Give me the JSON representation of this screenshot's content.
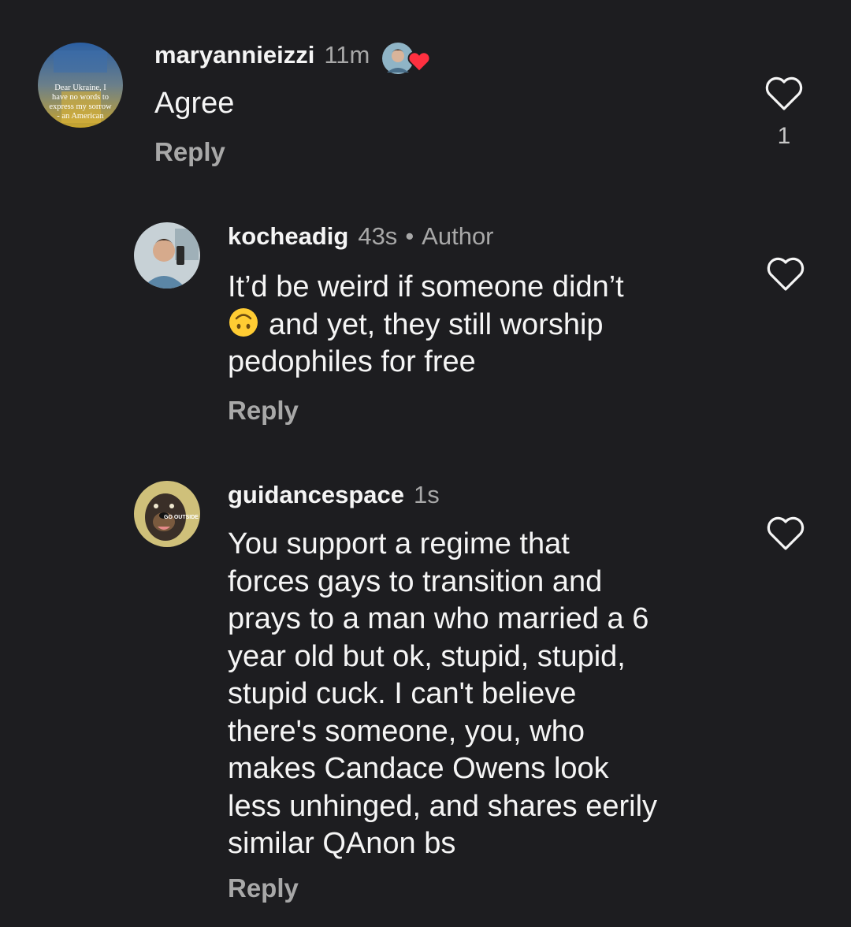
{
  "comments": [
    {
      "username": "maryannieizzi",
      "time": "11m",
      "text": "Agree",
      "reply_label": "Reply",
      "like_count": "1",
      "avatar_caption_lines": [
        "Dear Ukraine, I",
        "have no words to",
        "express my sorrow",
        "- an American"
      ],
      "has_author_reaction": true
    },
    {
      "username": "kocheadig",
      "time": "43s",
      "separator": "•",
      "author_badge": "Author",
      "text_lines": [
        "It’d be weird if someone didn’t",
        "and yet, they still worship",
        "pedophiles for free"
      ],
      "emoji": "upside-down-face",
      "reply_label": "Reply"
    },
    {
      "username": "guidancespace",
      "time": "1s",
      "text_lines": [
        "You support a regime that",
        "forces gays to transition and",
        "prays to a man who married a 6",
        "year old but ok, stupid, stupid,",
        "stupid cuck. I can't believe",
        "there's someone, you, who",
        "makes Candace Owens look",
        "less unhinged, and shares eerily",
        "similar QAnon bs"
      ],
      "avatar_caption": "GO OUTSIDE",
      "reply_label": "Reply"
    }
  ],
  "colors": {
    "background": "#1d1d20",
    "primary_text": "#f5f5f5",
    "secondary_text": "#a8a8a8",
    "heart_red": "#ff3040"
  },
  "icons": [
    "heart-outline-icon",
    "red-heart-icon",
    "upside-down-face-emoji"
  ]
}
